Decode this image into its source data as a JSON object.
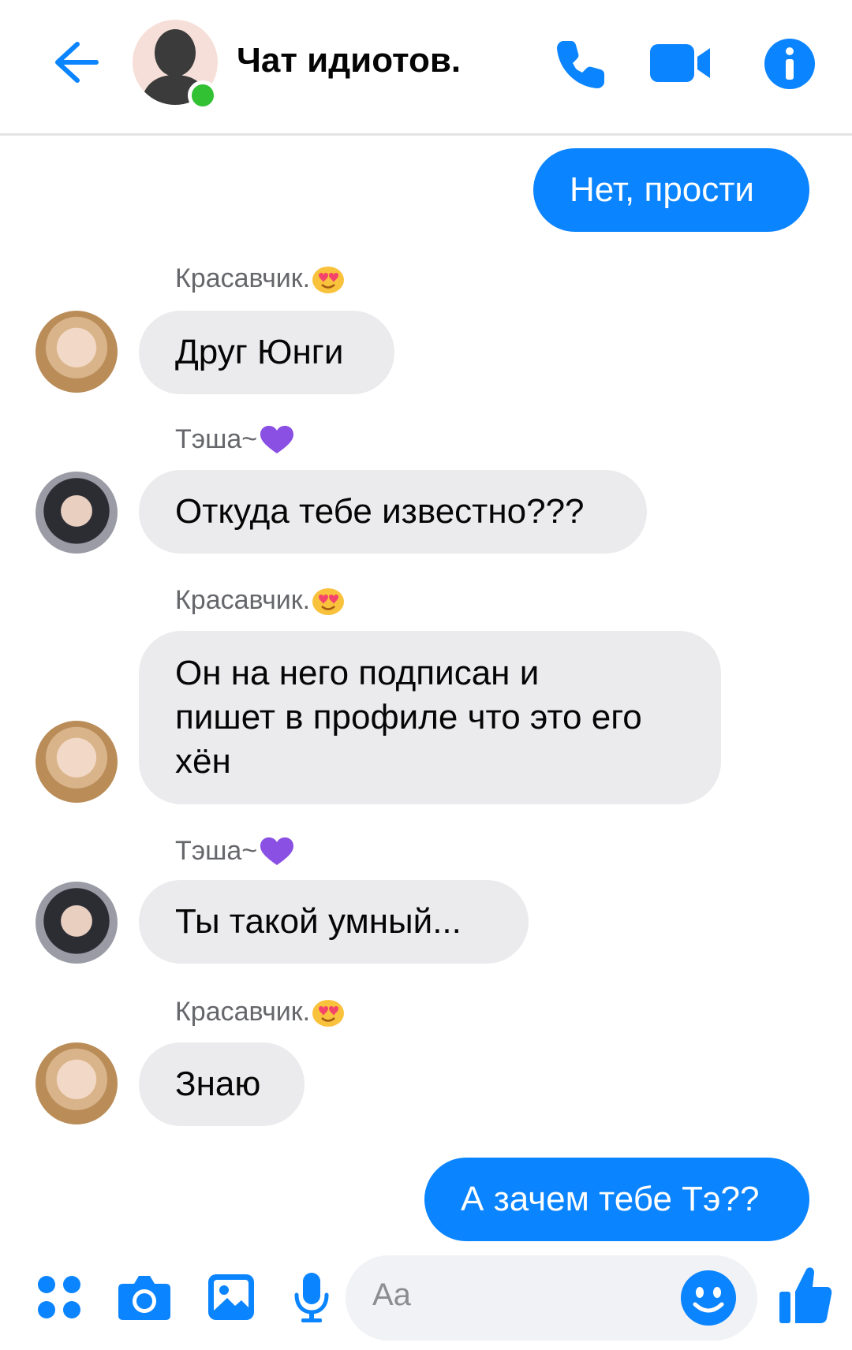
{
  "header": {
    "back_icon": "arrow-left-icon",
    "title": "Чат идиотов.",
    "status": "online",
    "actions": [
      "phone-icon",
      "video-camera-icon",
      "info-icon"
    ],
    "accent_color": "#0a84ff"
  },
  "messages": [
    {
      "direction": "out",
      "text": "Нет, прости"
    },
    {
      "direction": "in",
      "sender": "Красавчик.",
      "sender_emoji": "heart-eyes-face-icon",
      "text": "Друг Юнги"
    },
    {
      "direction": "in",
      "sender": "Тэша~",
      "sender_emoji": "purple-heart-icon",
      "text": "Откуда тебе известно???"
    },
    {
      "direction": "in",
      "sender": "Красавчик.",
      "sender_emoji": "heart-eyes-face-icon",
      "text_lines": [
        "Он на него подписан и",
        "пишет в профиле что это его",
        "хён"
      ]
    },
    {
      "direction": "in",
      "sender": "Тэша~",
      "sender_emoji": "purple-heart-icon",
      "text": "Ты такой умный..."
    },
    {
      "direction": "in",
      "sender": "Красавчик.",
      "sender_emoji": "heart-eyes-face-icon",
      "text": "Знаю"
    },
    {
      "direction": "out",
      "text": "А зачем тебе Тэ??"
    }
  ],
  "composer": {
    "placeholder": "Aa",
    "buttons": [
      "apps-grid-icon",
      "camera-icon",
      "gallery-icon",
      "microphone-icon",
      "emoji-smiley-icon",
      "thumbs-up-icon"
    ]
  },
  "colors": {
    "outgoing_bubble": "#0a84ff",
    "incoming_bubble": "#ebebed",
    "sender_name": "#65676b"
  }
}
